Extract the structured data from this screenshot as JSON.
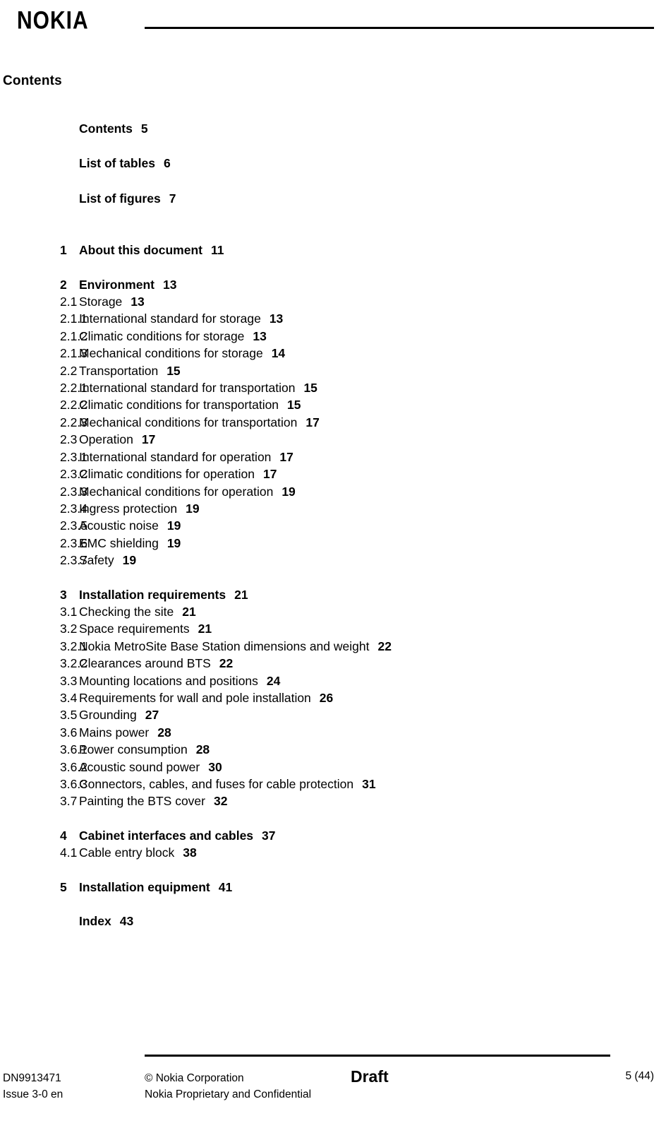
{
  "header": {
    "logo_text": "NOKIA"
  },
  "page_title": "Contents",
  "toc": {
    "front_matter": [
      {
        "num": "",
        "text": "Contents",
        "page": "5",
        "bold": true
      },
      {
        "num": "",
        "text": "List of tables",
        "page": "6",
        "bold": true
      },
      {
        "num": "",
        "text": "List of figures",
        "page": "7",
        "bold": true
      }
    ],
    "sections": [
      {
        "entries": [
          {
            "num": "1",
            "text": "About this document",
            "page": "11",
            "bold": true
          }
        ]
      },
      {
        "entries": [
          {
            "num": "2",
            "text": "Environment",
            "page": "13",
            "bold": true
          },
          {
            "num": "2.1",
            "text": "Storage",
            "page": "13",
            "bold": false
          },
          {
            "num": "2.1.1",
            "text": "International standard for storage",
            "page": "13",
            "bold": false
          },
          {
            "num": "2.1.2",
            "text": "Climatic conditions for storage",
            "page": "13",
            "bold": false
          },
          {
            "num": "2.1.3",
            "text": "Mechanical conditions for storage",
            "page": "14",
            "bold": false
          },
          {
            "num": "2.2",
            "text": "Transportation",
            "page": "15",
            "bold": false
          },
          {
            "num": "2.2.1",
            "text": "International standard for transportation",
            "page": "15",
            "bold": false
          },
          {
            "num": "2.2.2",
            "text": "Climatic conditions for transportation",
            "page": "15",
            "bold": false
          },
          {
            "num": "2.2.3",
            "text": "Mechanical conditions for transportation",
            "page": "17",
            "bold": false
          },
          {
            "num": "2.3",
            "text": "Operation",
            "page": "17",
            "bold": false
          },
          {
            "num": "2.3.1",
            "text": "International standard for operation",
            "page": "17",
            "bold": false
          },
          {
            "num": "2.3.2",
            "text": "Climatic conditions for operation",
            "page": "17",
            "bold": false
          },
          {
            "num": "2.3.3",
            "text": "Mechanical conditions for operation",
            "page": "19",
            "bold": false
          },
          {
            "num": "2.3.4",
            "text": "Ingress protection",
            "page": "19",
            "bold": false
          },
          {
            "num": "2.3.5",
            "text": "Acoustic noise",
            "page": "19",
            "bold": false
          },
          {
            "num": "2.3.6",
            "text": "EMC shielding",
            "page": "19",
            "bold": false
          },
          {
            "num": "2.3.7",
            "text": "Safety",
            "page": "19",
            "bold": false
          }
        ]
      },
      {
        "entries": [
          {
            "num": "3",
            "text": "Installation requirements",
            "page": "21",
            "bold": true
          },
          {
            "num": "3.1",
            "text": "Checking the site",
            "page": "21",
            "bold": false
          },
          {
            "num": "3.2",
            "text": "Space requirements",
            "page": "21",
            "bold": false
          },
          {
            "num": "3.2.1",
            "text": "Nokia MetroSite Base Station dimensions and weight",
            "page": "22",
            "bold": false
          },
          {
            "num": "3.2.2",
            "text": "Clearances around BTS",
            "page": "22",
            "bold": false
          },
          {
            "num": "3.3",
            "text": "Mounting locations and positions",
            "page": "24",
            "bold": false
          },
          {
            "num": "3.4",
            "text": "Requirements for wall and pole installation",
            "page": "26",
            "bold": false
          },
          {
            "num": "3.5",
            "text": "Grounding",
            "page": "27",
            "bold": false
          },
          {
            "num": "3.6",
            "text": "Mains power",
            "page": "28",
            "bold": false
          },
          {
            "num": "3.6.1",
            "text": "Power consumption",
            "page": "28",
            "bold": false
          },
          {
            "num": "3.6.2",
            "text": "Acoustic sound power",
            "page": "30",
            "bold": false
          },
          {
            "num": "3.6.3",
            "text": "Connectors, cables, and fuses for cable protection",
            "page": "31",
            "bold": false
          },
          {
            "num": "3.7",
            "text": "Painting the BTS cover",
            "page": "32",
            "bold": false
          }
        ]
      },
      {
        "entries": [
          {
            "num": "4",
            "text": "Cabinet interfaces and cables",
            "page": "37",
            "bold": true
          },
          {
            "num": "4.1",
            "text": "Cable entry block",
            "page": "38",
            "bold": false
          }
        ]
      },
      {
        "entries": [
          {
            "num": "5",
            "text": "Installation equipment",
            "page": "41",
            "bold": true
          }
        ]
      },
      {
        "entries": [
          {
            "num": "",
            "text": "Index",
            "page": "43",
            "bold": true
          }
        ]
      }
    ]
  },
  "footer": {
    "doc_number": "DN9913471",
    "issue": "Issue 3-0 en",
    "copyright": "© Nokia Corporation",
    "confidentiality": "Nokia Proprietary and Confidential",
    "watermark": "Draft",
    "page_number": "5 (44)"
  }
}
